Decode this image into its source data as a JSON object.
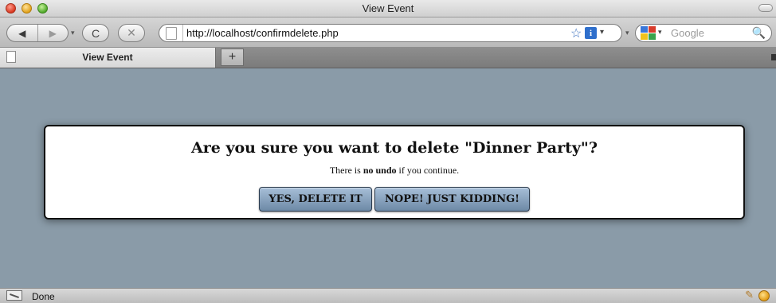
{
  "window": {
    "title": "View Event"
  },
  "toolbar": {
    "back_icon": "◀",
    "forward_icon": "▶",
    "reload_icon": "C",
    "stop_icon": "✕",
    "url": "http://localhost/confirmdelete.php",
    "bookmark_icon": "☆",
    "info_icon": "i",
    "dropdown_icon": "▾",
    "search_placeholder": "Google",
    "search_icon": "🔍"
  },
  "tabs": [
    {
      "label": "View Event",
      "active": true
    }
  ],
  "new_tab_label": "+",
  "dialog": {
    "heading": "Are you sure you want to delete \"Dinner Party\"?",
    "message_prefix": "There is ",
    "message_bold": "no undo",
    "message_suffix": " if you continue.",
    "confirm_label": "YES, DELETE IT",
    "cancel_label": "NOPE! JUST KIDDING!"
  },
  "status": {
    "text": "Done"
  },
  "colors": {
    "content_background": "#8a9ba8",
    "button_gradient_top": "#a7bfd8",
    "button_gradient_bottom": "#6d89a6"
  }
}
